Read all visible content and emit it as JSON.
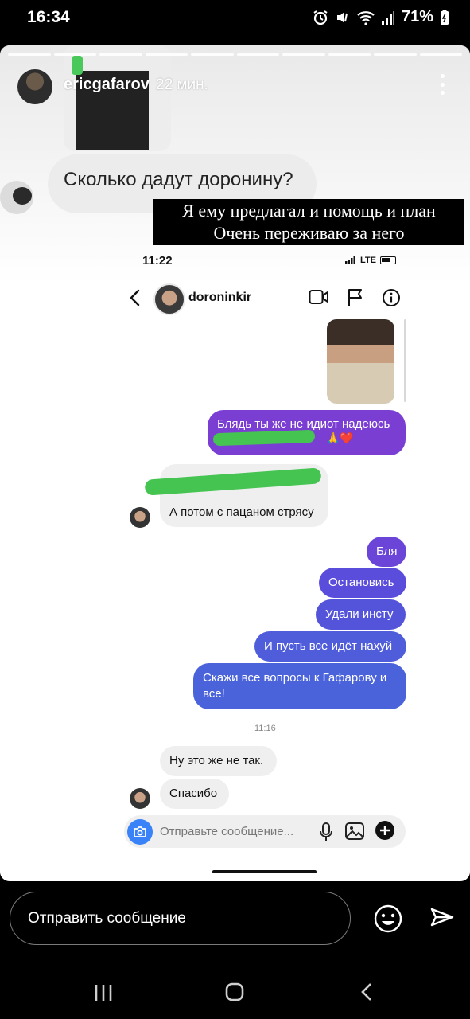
{
  "status_bar": {
    "time": "16:34",
    "battery": "71%"
  },
  "story": {
    "username": "ericgafarov",
    "time_ago": "22 мин.",
    "question": "Сколько дадут доронину?",
    "caption_line1": "Я ему предлагал и помощь и план",
    "caption_line2": "Очень переживаю за него"
  },
  "chat": {
    "status_time": "11:22",
    "network": "LTE",
    "username": "doroninkir",
    "messages": {
      "out1": "Блядь ты же не идиот надеюсь",
      "out1_emoji": "🙏❤️",
      "in1": "А потом с пацаном стрясу",
      "out2": "Бля",
      "out3": "Остановись",
      "out4": "Удали инсту",
      "out5": "И пусть все идёт нахуй",
      "out6": "Скажи все вопросы к Гафарову и все!",
      "time_separator": "11:16",
      "in2": "Ну это же не так.",
      "in3": "Спасибо"
    },
    "composer_placeholder": "Отправьте сообщение..."
  },
  "reply": {
    "placeholder": "Отправить сообщение"
  }
}
